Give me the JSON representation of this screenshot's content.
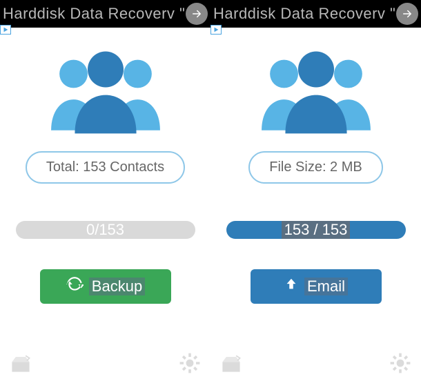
{
  "ads": [
    {
      "label": "Harddisk Data Recoverv \""
    },
    {
      "label": "Harddisk Data Recoverv \""
    }
  ],
  "left": {
    "info_label": "Total: 153 Contacts",
    "progress_text": "0/153",
    "action_label": "Backup"
  },
  "right": {
    "info_label": "File Size: 2 MB",
    "progress_text": "153 / 153",
    "action_label": "Email"
  },
  "colors": {
    "accent_blue": "#2f7db8",
    "light_blue": "#58b4e5",
    "green": "#3aa757",
    "grey": "#d9d9d9"
  }
}
